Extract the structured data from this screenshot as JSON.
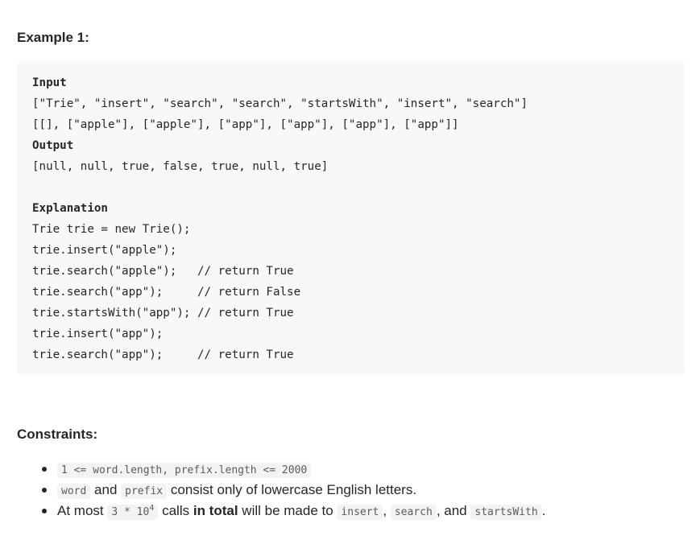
{
  "example": {
    "heading": "Example 1:",
    "lines": [
      {
        "text": "Input",
        "bold": true
      },
      {
        "text": "[\"Trie\", \"insert\", \"search\", \"search\", \"startsWith\", \"insert\", \"search\"]",
        "bold": false
      },
      {
        "text": "[[], [\"apple\"], [\"apple\"], [\"app\"], [\"app\"], [\"app\"], [\"app\"]]",
        "bold": false
      },
      {
        "text": "Output",
        "bold": true
      },
      {
        "text": "[null, null, true, false, true, null, true]",
        "bold": false
      },
      {
        "text": "",
        "bold": false
      },
      {
        "text": "Explanation",
        "bold": true
      },
      {
        "text": "Trie trie = new Trie();",
        "bold": false
      },
      {
        "text": "trie.insert(\"apple\");",
        "bold": false
      },
      {
        "text": "trie.search(\"apple\");   // return True",
        "bold": false
      },
      {
        "text": "trie.search(\"app\");     // return False",
        "bold": false
      },
      {
        "text": "trie.startsWith(\"app\"); // return True",
        "bold": false
      },
      {
        "text": "trie.insert(\"app\");",
        "bold": false
      },
      {
        "text": "trie.search(\"app\");     // return True",
        "bold": false
      }
    ]
  },
  "constraints": {
    "heading": "Constraints:",
    "items": [
      {
        "code": "1 <= word.length, prefix.length <= 2000"
      },
      {
        "code1": "word",
        "text1": "and",
        "code2": "prefix",
        "text2": "consist only of lowercase English letters."
      },
      {
        "text1": "At most",
        "code_base": "3 * 10",
        "code_exp": "4",
        "text2": "calls",
        "strong": "in total",
        "text3": "will be made to",
        "code1": "insert",
        "sep1": ",",
        "code2": "search",
        "sep2": ", and",
        "code3": "startsWith",
        "end": "."
      }
    ]
  }
}
